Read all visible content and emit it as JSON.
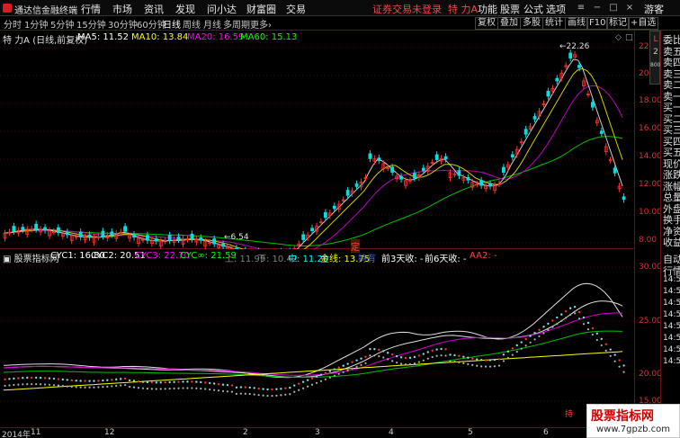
{
  "app": {
    "title": "通达信金融终端",
    "menus": [
      "行情",
      "市场",
      "资讯",
      "发现",
      "问小达",
      "财富圈",
      "交易"
    ],
    "notice": "证券交易未登录",
    "stock_tag": "特 力A",
    "right_menus": [
      "功能",
      "股票",
      "公式",
      "选项"
    ],
    "guest": "游客"
  },
  "toolbar": {
    "periods": [
      "分时",
      "1分钟",
      "5分钟",
      "15分钟",
      "30分钟",
      "60分钟",
      "日线",
      "周线",
      "月线",
      "多周期",
      "更多"
    ],
    "active_period": "日线",
    "more_arrow": "›",
    "tools": [
      "复权",
      "叠加",
      "多股",
      "统计",
      "画线",
      "F10",
      "标记",
      "+自选"
    ]
  },
  "main": {
    "stock_label": "特 力A (日线,前复权)",
    "ma_labels": [
      {
        "text": "MA5: 11.52",
        "color": "#ffffff"
      },
      {
        "text": "MA10: 13.84",
        "color": "#ffff00"
      },
      {
        "text": "MA20: 16.59",
        "color": "#ff00ff"
      },
      {
        "text": "MA60: 15.13",
        "color": "#00ff00"
      }
    ],
    "price_ticks": [
      "22.00",
      "20.00",
      "18.00",
      "16.00",
      "14.00",
      "12.00",
      "10.00",
      "8.00"
    ],
    "high_label": "22.26",
    "low_label": "6.54",
    "mid_marker": "定"
  },
  "indicator": {
    "name": "股票指标网",
    "labels": [
      {
        "text": "CYC1: 16.80",
        "color": "#ffffff"
      },
      {
        "text": "CYC2: 20.51",
        "color": "#ffffff"
      },
      {
        "text": "CYC3: 22.70",
        "color": "#ff00ff"
      },
      {
        "text": "CYC∞: 21.59",
        "color": "#00ff00"
      },
      {
        "text": "上: 11.99",
        "color": "#808080"
      },
      {
        "text": "下: 10.42",
        "color": "#808080"
      },
      {
        "text": "中: 11.20",
        "color": "#00ffff"
      },
      {
        "text": "金线: 13.75",
        "color": "#ffff00"
      },
      {
        "text": "持有",
        "color": "#4060ff"
      },
      {
        "text": "前3天收: -",
        "color": "#ffffff"
      },
      {
        "text": "前6天收: -",
        "color": "#ffffff"
      },
      {
        "text": "AA2: -",
        "color": "#ff4040"
      }
    ],
    "ticks": [
      "30.00",
      "25.00",
      "20.00",
      "15.00"
    ],
    "marker": "持"
  },
  "right_panel": {
    "top": [
      "委比",
      "卖五",
      "卖四",
      "卖三",
      "卖二",
      "卖一",
      "买一",
      "买二",
      "买三",
      "买四",
      "买五",
      "现价",
      "涨跌",
      "涨幅",
      "总量",
      "外盘",
      "换手",
      "净资",
      "收益"
    ],
    "bottom": [
      "自动",
      "行情",
      "14:50",
      "14:50",
      "14:50",
      "14:50",
      "14:50",
      "14:50",
      "14:50",
      "14:50"
    ],
    "tab_chars": [
      "L",
      "2",
      "8000"
    ]
  },
  "dates": [
    "2014年",
    "11",
    "12",
    "2",
    "3",
    "4",
    "5",
    "6"
  ],
  "watermark": {
    "line1": "股票指标网",
    "line2": "www.7gpzb.com"
  },
  "colors": {
    "up": "#ff3030",
    "down": "#00ffff",
    "frame": "#6a1010"
  }
}
